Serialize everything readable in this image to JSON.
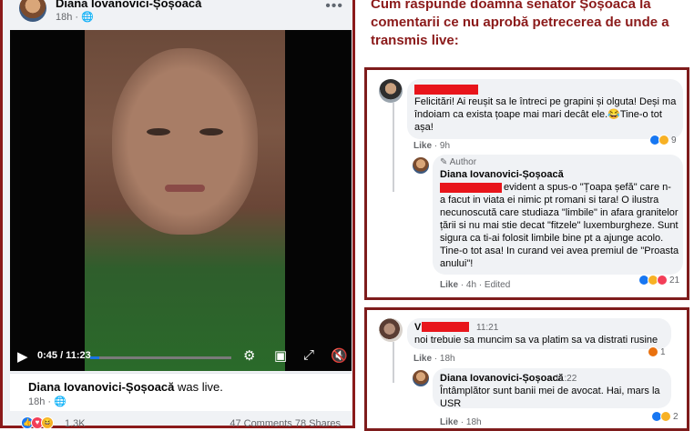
{
  "left": {
    "post_author": "Diana Iovanovici-Șoșoacă",
    "post_time": "18h · ",
    "globe_icon": "globe-icon",
    "more_label": "•••",
    "video": {
      "time": "0:45 / 11:23",
      "progress": 0.066
    },
    "caption_name": "Diana Iovanovici-Șoșoacă",
    "caption_rest": " was live.",
    "caption_time": "18h · ",
    "reaction_count": "1.3K",
    "comments_shares": "47 Comments  78 Shares"
  },
  "right": {
    "heading": "Cum răspunde doamna senator Șoșoacă la comentarii ce nu aprobă petrecerea de unde a transmis live:",
    "c1_text": "Felicitări! Ai reușit sa le întreci pe grapini și olguta! Deși ma îndoiam ca exista țoape mai mari decât ele.😂Tine-o tot așa!",
    "c1_meta_like": "Like",
    "c1_meta_time": " · 9h",
    "c1_react_count": "9",
    "r1_badge": "✎ Author",
    "r1_name": "Diana Iovanovici-Șoșoacă",
    "r1_text_first": "evident a spus-o \"Țoapa șefă\" care n-",
    "r1_text_rest": "a facut in viata ei nimic pt romani si tara! O ilustra necunoscută care studiaza \"limbile\" in afara granitelor țării si nu mai stie decat \"fitzele\" luxemburgheze. Sunt sigura ca ti-ai folosit limbile bine pt a ajunge acolo. Tine-o tot asa! In curand vei avea premiul de \"Proasta anului\"!",
    "r1_meta_like": "Like",
    "r1_meta_time": " · 4h · Edited",
    "r1_react_count": "21",
    "c2_name_initial": "V",
    "c2_time": "11:21",
    "c2_text": "noi trebuie sa muncim sa va platim sa va distrati rusine",
    "c2_meta_like": "Like",
    "c2_meta_time": " · 18h",
    "c2_react_count": "1",
    "r2_name": "Diana Iovanovici-Șoșoacă",
    "r2_time": "11:22",
    "r2_text": "Întâmplător sunt banii mei de avocat. Hai, mars la USR",
    "r2_meta_like": "Like",
    "r2_meta_time": " · 18h",
    "r2_react_count": "2"
  },
  "colors": {
    "border": "#8b1a1a",
    "like_blue": "#1877f2",
    "redact": "#e8151b"
  }
}
